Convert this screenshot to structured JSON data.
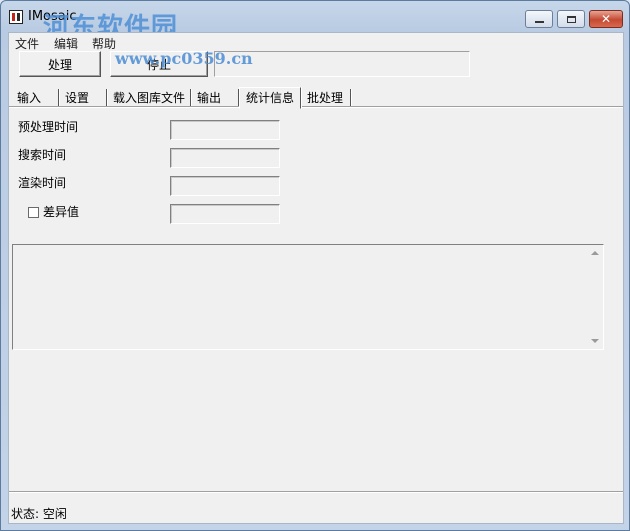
{
  "window": {
    "title": "IMosaic",
    "watermark": "河东软件园",
    "watermark_url": "www.pc0359.cn"
  },
  "menu": [
    "文件",
    "编辑",
    "帮助"
  ],
  "toolbar": {
    "process_label": "处理",
    "stop_label": "停止"
  },
  "tabs": [
    "输入",
    "设置",
    "载入图库文件",
    "输出",
    "统计信息",
    "批处理"
  ],
  "active_tab": "统计信息",
  "stats": {
    "preprocess_label": "预处理时间",
    "search_label": "搜索时间",
    "render_label": "渲染时间",
    "diff_label": "差异值"
  },
  "status": {
    "text": "状态:  空闲"
  }
}
